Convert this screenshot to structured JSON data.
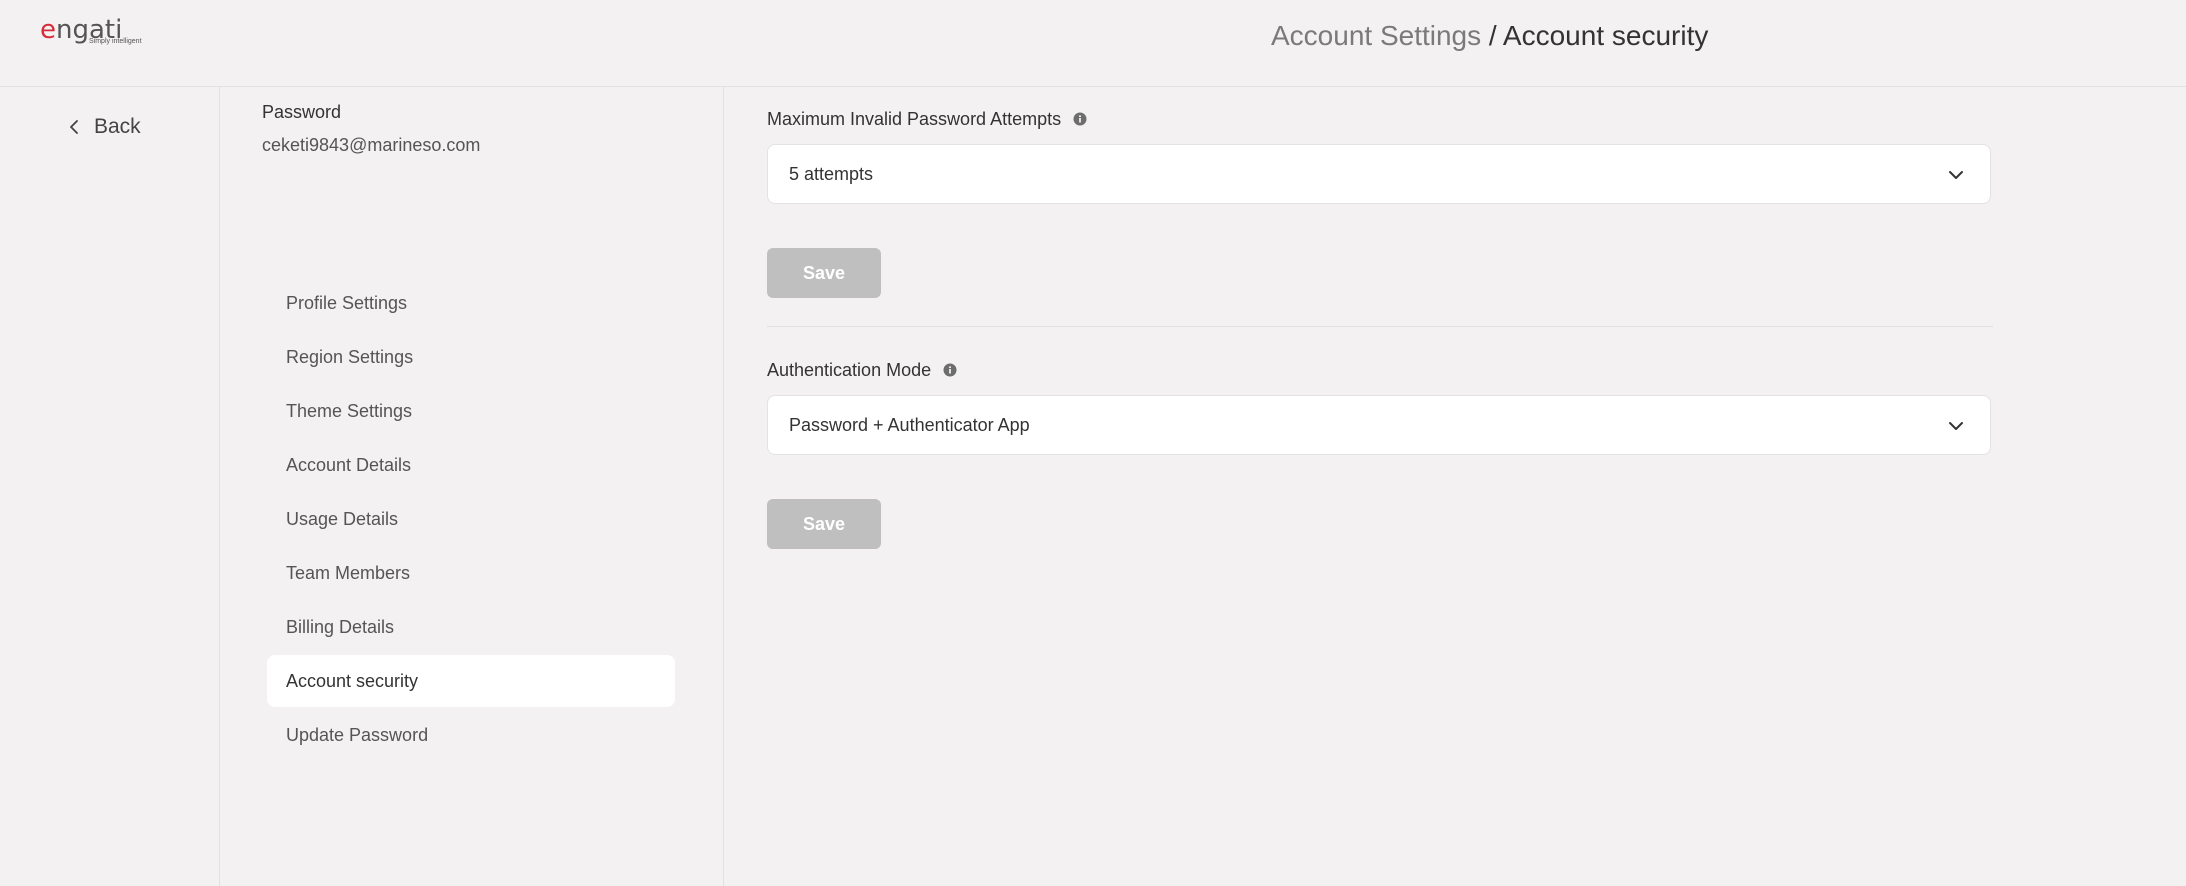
{
  "header": {
    "logo_word_e": "e",
    "logo_word_rest": "ngati",
    "logo_tagline": "Simply intelligent",
    "breadcrumb_parent": "Account Settings",
    "breadcrumb_separator": " / ",
    "breadcrumb_current": "Account security"
  },
  "back": {
    "label": "Back"
  },
  "account": {
    "password_label": "Password",
    "email": "ceketi9843@marineso.com"
  },
  "nav": {
    "items": [
      {
        "label": "Profile Settings",
        "active": false
      },
      {
        "label": "Region Settings",
        "active": false
      },
      {
        "label": "Theme Settings",
        "active": false
      },
      {
        "label": "Account Details",
        "active": false
      },
      {
        "label": "Usage Details",
        "active": false
      },
      {
        "label": "Team Members",
        "active": false
      },
      {
        "label": "Billing Details",
        "active": false
      },
      {
        "label": "Account security",
        "active": true
      },
      {
        "label": "Update Password",
        "active": false
      }
    ]
  },
  "invalid_attempts": {
    "label": "Maximum Invalid Password Attempts",
    "info_icon": "info-icon",
    "selected": "5 attempts",
    "save_label": "Save"
  },
  "auth_mode": {
    "label": "Authentication Mode",
    "info_icon": "info-icon",
    "selected": "Password + Authenticator App",
    "save_label": "Save"
  },
  "colors": {
    "background": "#f3f1f2",
    "brand_red": "#d62c3b",
    "save_disabled": "#c0bfc0",
    "active_nav": "#ffffff"
  }
}
